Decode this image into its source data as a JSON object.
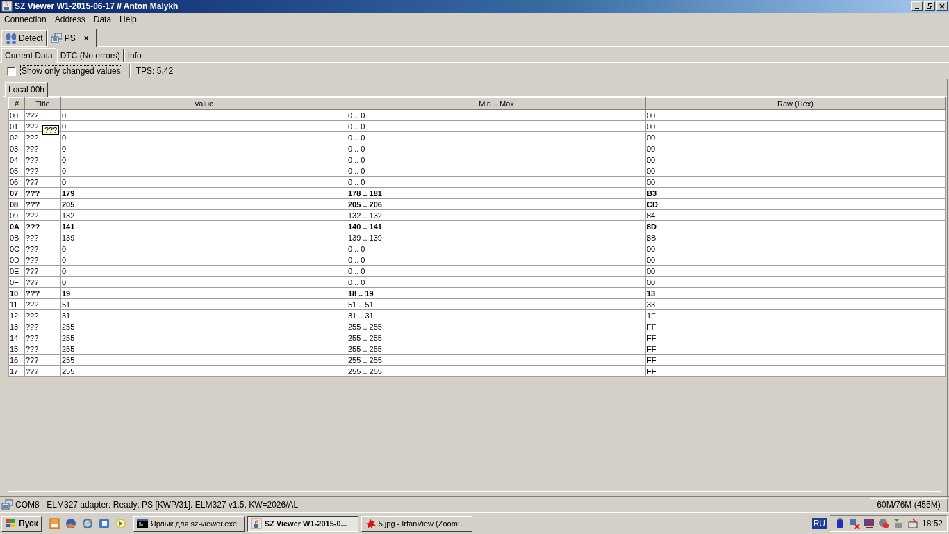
{
  "window": {
    "title": "SZ Viewer W1-2015-06-17 // Anton Malykh"
  },
  "menu": [
    "Connection",
    "Address",
    "Data",
    "Help"
  ],
  "doc_tabs": [
    {
      "label": "Detect",
      "selected": false,
      "kind": "detect"
    },
    {
      "label": "PS",
      "selected": true,
      "kind": "device",
      "close": "×"
    }
  ],
  "sub_tabs": [
    {
      "label": "Current Data",
      "selected": true
    },
    {
      "label": "DTC (No errors)",
      "selected": false
    },
    {
      "label": "Info",
      "selected": false
    }
  ],
  "filter": {
    "label": "Show only changed values",
    "checked": false
  },
  "tps": "TPS: 5.42",
  "table_tabs": [
    {
      "label": "Local 00h",
      "selected": true
    }
  ],
  "table": {
    "columns": [
      "#",
      "Title",
      "Value",
      "Min .. Max",
      "Raw (Hex)"
    ],
    "rows": [
      {
        "changed": false,
        "cells": [
          "00",
          "???",
          "0",
          "0 .. 0",
          "00"
        ]
      },
      {
        "changed": false,
        "cells": [
          "01",
          "???",
          "0",
          "0 .. 0",
          "00"
        ]
      },
      {
        "changed": false,
        "cells": [
          "02",
          "???",
          "0",
          "0 .. 0",
          "00"
        ]
      },
      {
        "changed": false,
        "cells": [
          "03",
          "???",
          "0",
          "0 .. 0",
          "00"
        ]
      },
      {
        "changed": false,
        "cells": [
          "04",
          "???",
          "0",
          "0 .. 0",
          "00"
        ]
      },
      {
        "changed": false,
        "cells": [
          "05",
          "???",
          "0",
          "0 .. 0",
          "00"
        ]
      },
      {
        "changed": false,
        "cells": [
          "06",
          "???",
          "0",
          "0 .. 0",
          "00"
        ]
      },
      {
        "changed": true,
        "cells": [
          "07",
          "???",
          "179",
          "178 .. 181",
          "B3"
        ]
      },
      {
        "changed": true,
        "cells": [
          "08",
          "???",
          "205",
          "205 .. 206",
          "CD"
        ]
      },
      {
        "changed": false,
        "cells": [
          "09",
          "???",
          "132",
          "132 .. 132",
          "84"
        ]
      },
      {
        "changed": true,
        "cells": [
          "0A",
          "???",
          "141",
          "140 .. 141",
          "8D"
        ]
      },
      {
        "changed": false,
        "cells": [
          "0B",
          "???",
          "139",
          "139 .. 139",
          "8B"
        ]
      },
      {
        "changed": false,
        "cells": [
          "0C",
          "???",
          "0",
          "0 .. 0",
          "00"
        ]
      },
      {
        "changed": false,
        "cells": [
          "0D",
          "???",
          "0",
          "0 .. 0",
          "00"
        ]
      },
      {
        "changed": false,
        "cells": [
          "0E",
          "???",
          "0",
          "0 .. 0",
          "00"
        ]
      },
      {
        "changed": false,
        "cells": [
          "0F",
          "???",
          "0",
          "0 .. 0",
          "00"
        ]
      },
      {
        "changed": true,
        "cells": [
          "10",
          "???",
          "19",
          "18 .. 19",
          "13"
        ]
      },
      {
        "changed": false,
        "cells": [
          "11",
          "???",
          "51",
          "51 .. 51",
          "33"
        ]
      },
      {
        "changed": false,
        "cells": [
          "12",
          "???",
          "31",
          "31 .. 31",
          "1F"
        ]
      },
      {
        "changed": false,
        "cells": [
          "13",
          "???",
          "255",
          "255 .. 255",
          "FF"
        ]
      },
      {
        "changed": false,
        "cells": [
          "14",
          "???",
          "255",
          "255 .. 255",
          "FF"
        ]
      },
      {
        "changed": false,
        "cells": [
          "15",
          "???",
          "255",
          "255 .. 255",
          "FF"
        ]
      },
      {
        "changed": false,
        "cells": [
          "16",
          "???",
          "255",
          "255 .. 255",
          "FF"
        ]
      },
      {
        "changed": false,
        "cells": [
          "17",
          "???",
          "255",
          "255 .. 255",
          "FF"
        ]
      }
    ]
  },
  "tooltip": "???",
  "status_bar": {
    "message": "COM8 - ELM327 adapter: Ready: PS [KWP/31]. ELM327 v1.5, KW=2026/AL",
    "memory": "60M/76M (455M)"
  },
  "taskbar": {
    "start": "Пуск",
    "quick_launch": [
      {
        "kind": "pdf"
      },
      {
        "kind": "browser"
      },
      {
        "kind": "globe"
      },
      {
        "kind": "doc"
      },
      {
        "kind": "player"
      }
    ],
    "tasks": [
      {
        "label": "Ярлык для sz-viewer.exe",
        "selected": false,
        "kind": "console"
      },
      {
        "label": "SZ Viewer W1-2015-0...",
        "selected": true,
        "kind": "java"
      },
      {
        "label": "5.jpg - IrfanView (Zoom:...",
        "selected": false,
        "kind": "splash"
      }
    ],
    "language": "RU",
    "clock": "18:52"
  }
}
